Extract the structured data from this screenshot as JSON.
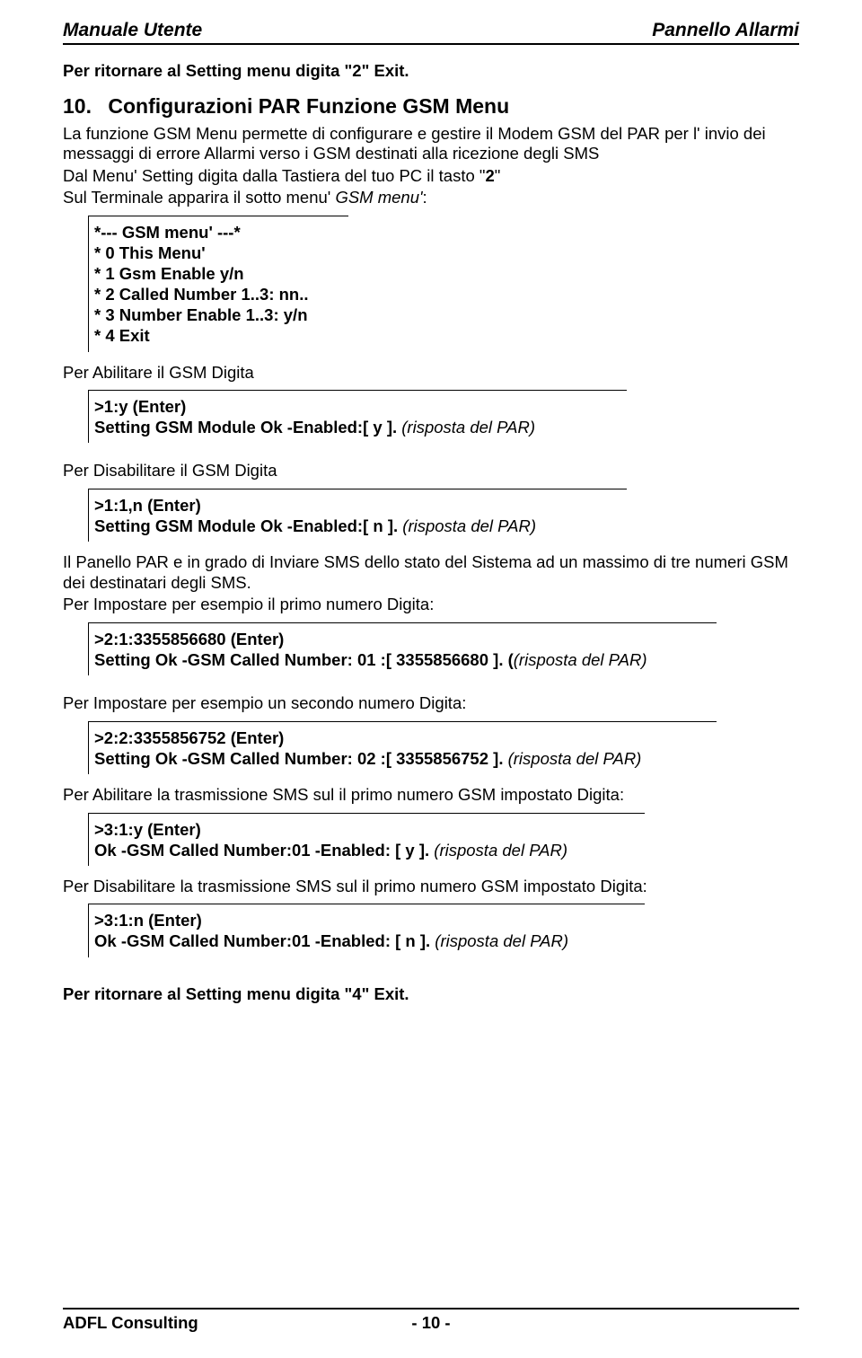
{
  "header": {
    "left": "Manuale Utente",
    "right": "Pannello Allarmi"
  },
  "intro_return": "Per ritornare al  Setting menu digita \"2\" Exit.",
  "section": {
    "num": "10.",
    "title": "Configurazioni PAR Funzione GSM Menu"
  },
  "p1_a": "La funzione GSM Menu permette di configurare e gestire il Modem GSM del PAR per  l' invio dei messaggi di errore Allarmi verso i GSM destinati alla ricezione degli SMS",
  "p1_b_pre": "Dal Menu' Setting digita dalla Tastiera del tuo PC il tasto \"",
  "p1_b_bold": "2",
  "p1_b_post": "\"",
  "p1_c_pre": "Sul Terminale apparira il sotto menu' ",
  "p1_c_italic": "GSM menu'",
  "p1_c_post": ":",
  "gsm_menu": [
    "*--- GSM  menu' ---*",
    "* 0 This Menu'",
    "* 1 Gsm Enable y/n",
    "* 2 Called Number 1..3: nn..",
    "* 3 Number Enable 1..3: y/n",
    "* 4 Exit"
  ],
  "enable_gsm_label": "Per Abilitare il GSM Digita",
  "enable_gsm_box": {
    "line1": ">1:y (Enter)",
    "line2_bold": "Setting GSM Module Ok -Enabled:[ y ]. ",
    "line2_italic": "(risposta del PAR)"
  },
  "disable_gsm_label": "Per Disabilitare il GSM Digita",
  "disable_gsm_box": {
    "line1": ">1:1,n (Enter)",
    "line2_bold": "Setting GSM Module Ok -Enabled:[ n ]. ",
    "line2_italic": "(risposta del PAR)"
  },
  "p2_a": "Il Panello PAR e in grado di Inviare SMS dello stato del Sistema ad un massimo di tre numeri GSM dei destinatari degli SMS.",
  "p2_b": "Per Impostare per esempio il primo numero Digita:",
  "set_num1_box": {
    "line1": ">2:1:3355856680 (Enter)",
    "line2_bold": "Setting Ok -GSM Called Number: 01 :[ 3355856680 ]. (",
    "line2_italic": "(risposta del PAR)"
  },
  "p3": "Per Impostare per esempio un secondo numero Digita:",
  "set_num2_box": {
    "line1": ">2:2:3355856752 (Enter)",
    "line2_bold": "Setting Ok -GSM Called Number: 02 :[ 3355856752 ]. ",
    "line2_italic": "(risposta del PAR)"
  },
  "p4": "Per Abilitare la trasmissione SMS sul il primo numero GSM impostato Digita:",
  "enable_tx_box": {
    "line1": ">3:1:y (Enter)",
    "line2_bold": "Ok -GSM Called Number:01  -Enabled: [ y ]. ",
    "line2_italic": "(risposta del PAR)"
  },
  "p5": "Per Disabilitare la trasmissione SMS sul il primo numero GSM impostato Digita:",
  "disable_tx_box": {
    "line1": ">3:1:n (Enter)",
    "line2_bold": "Ok -GSM Called Number:01  -Enabled: [ n ]. ",
    "line2_italic": "(risposta del PAR)"
  },
  "outro_return": "Per ritornare al  Setting menu digita \"4\" Exit.",
  "footer": {
    "left": "ADFL Consulting",
    "center": "- 10 -"
  }
}
